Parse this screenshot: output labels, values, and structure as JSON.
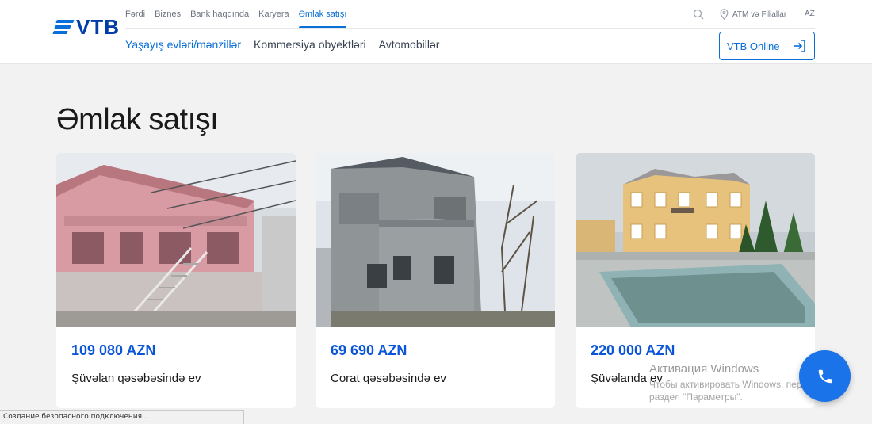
{
  "brand": {
    "logo_text": "VTB",
    "accent": "#0a6fd8"
  },
  "top_nav": [
    {
      "label": "Fərdi",
      "active": false
    },
    {
      "label": "Biznes",
      "active": false
    },
    {
      "label": "Bank haqqında",
      "active": false
    },
    {
      "label": "Karyera",
      "active": false
    },
    {
      "label": "Əmlak satışı",
      "active": true
    }
  ],
  "utility": {
    "search_icon": "search-icon",
    "atm_label": "ATM və Filiallar",
    "lang": "AZ"
  },
  "sub_nav": [
    {
      "label": "Yaşayış evləri/mənzillər",
      "active": true
    },
    {
      "label": "Kommersiya obyektləri",
      "active": false
    },
    {
      "label": "Avtomobillər",
      "active": false
    }
  ],
  "vtb_online": {
    "label": "VTB Online",
    "icon": "login-icon"
  },
  "page_title": "Əmlak satışı",
  "listings": [
    {
      "price": "109 080 AZN",
      "title": "Şüvəlan qəsəbəsində ev"
    },
    {
      "price": "69 690 AZN",
      "title": "Corat qəsəbəsində ev"
    },
    {
      "price": "220 000 AZN",
      "title": "Şüvəlanda ev"
    }
  ],
  "watermark": {
    "title": "Активация Windows",
    "subtitle": "Чтобы активировать Windows, перейдите в раздел \"Параметры\"."
  },
  "call_button": {
    "icon": "phone-icon"
  },
  "status_bar": "Создание безопасного подключения..."
}
